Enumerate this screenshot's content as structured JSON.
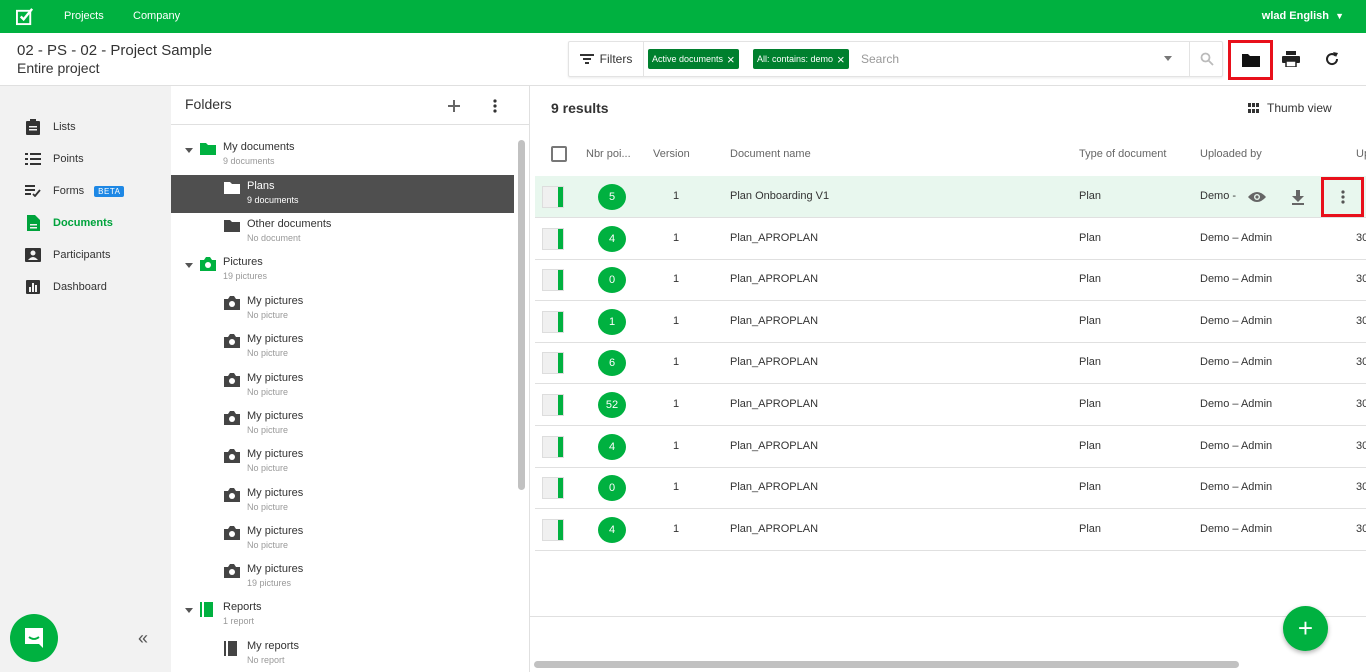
{
  "topbar": {
    "nav": [
      "Projects",
      "Company"
    ],
    "user": "wlad English"
  },
  "header": {
    "project_title": "02 - PS - 02 - Project Sample",
    "project_scope": "Entire project",
    "filters_label": "Filters",
    "chips": [
      "Active documents",
      "All: contains: demo"
    ],
    "search_placeholder": "Search"
  },
  "sidebar": {
    "items": [
      {
        "label": "Lists",
        "icon": "clipboard-icon"
      },
      {
        "label": "Points",
        "icon": "list-icon"
      },
      {
        "label": "Forms",
        "icon": "checklist-icon",
        "badge": "BETA"
      },
      {
        "label": "Documents",
        "icon": "document-icon",
        "active": true
      },
      {
        "label": "Participants",
        "icon": "contact-card-icon"
      },
      {
        "label": "Dashboard",
        "icon": "bar-chart-icon"
      }
    ]
  },
  "folders": {
    "title": "Folders",
    "tree": [
      {
        "name": "My documents",
        "sub": "9 documents",
        "level": 0,
        "type": "folder-green"
      },
      {
        "name": "Plans",
        "sub": "9 documents",
        "level": 1,
        "type": "folder-white",
        "selected": true
      },
      {
        "name": "Other documents",
        "sub": "No document",
        "level": 1,
        "type": "folder-dark"
      },
      {
        "name": "Pictures",
        "sub": "19 pictures",
        "level": 0,
        "type": "camera-green"
      },
      {
        "name": "My pictures",
        "sub": "No picture",
        "level": 1,
        "type": "camera-dark"
      },
      {
        "name": "My pictures",
        "sub": "No picture",
        "level": 1,
        "type": "camera-dark"
      },
      {
        "name": "My pictures",
        "sub": "No picture",
        "level": 1,
        "type": "camera-dark"
      },
      {
        "name": "My pictures",
        "sub": "No picture",
        "level": 1,
        "type": "camera-dark"
      },
      {
        "name": "My pictures",
        "sub": "No picture",
        "level": 1,
        "type": "camera-dark"
      },
      {
        "name": "My pictures",
        "sub": "No picture",
        "level": 1,
        "type": "camera-dark"
      },
      {
        "name": "My pictures",
        "sub": "No picture",
        "level": 1,
        "type": "camera-dark"
      },
      {
        "name": "My pictures",
        "sub": "19 pictures",
        "level": 1,
        "type": "camera-dark"
      },
      {
        "name": "Reports",
        "sub": "1 report",
        "level": 0,
        "type": "report-green"
      },
      {
        "name": "My reports",
        "sub": "No report",
        "level": 1,
        "type": "report-dark"
      }
    ]
  },
  "main": {
    "results": "9 results",
    "thumb_view": "Thumb view",
    "columns": [
      "Nbr poi...",
      "Version",
      "Document name",
      "Type of document",
      "Uploaded by",
      "Up"
    ],
    "rows": [
      {
        "points": "5",
        "version": "1",
        "name": "Plan Onboarding V1",
        "type": "Plan",
        "uploaded_by": "Demo -",
        "up": ""
      },
      {
        "points": "4",
        "version": "1",
        "name": "Plan_APROPLAN",
        "type": "Plan",
        "uploaded_by": "Demo – Admin",
        "up": "30"
      },
      {
        "points": "0",
        "version": "1",
        "name": "Plan_APROPLAN",
        "type": "Plan",
        "uploaded_by": "Demo – Admin",
        "up": "30"
      },
      {
        "points": "1",
        "version": "1",
        "name": "Plan_APROPLAN",
        "type": "Plan",
        "uploaded_by": "Demo – Admin",
        "up": "30"
      },
      {
        "points": "6",
        "version": "1",
        "name": "Plan_APROPLAN",
        "type": "Plan",
        "uploaded_by": "Demo – Admin",
        "up": "30"
      },
      {
        "points": "52",
        "version": "1",
        "name": "Plan_APROPLAN",
        "type": "Plan",
        "uploaded_by": "Demo – Admin",
        "up": "30"
      },
      {
        "points": "4",
        "version": "1",
        "name": "Plan_APROPLAN",
        "type": "Plan",
        "uploaded_by": "Demo – Admin",
        "up": "30"
      },
      {
        "points": "0",
        "version": "1",
        "name": "Plan_APROPLAN",
        "type": "Plan",
        "uploaded_by": "Demo – Admin",
        "up": "30"
      },
      {
        "points": "4",
        "version": "1",
        "name": "Plan_APROPLAN",
        "type": "Plan",
        "uploaded_by": "Demo – Admin",
        "up": "30"
      }
    ],
    "fab": "+"
  },
  "colors": {
    "brand_green": "#00b140",
    "chip_green": "#00802e",
    "highlight_red": "#e8101b",
    "selected_row_bg": "#e8f7ee"
  }
}
